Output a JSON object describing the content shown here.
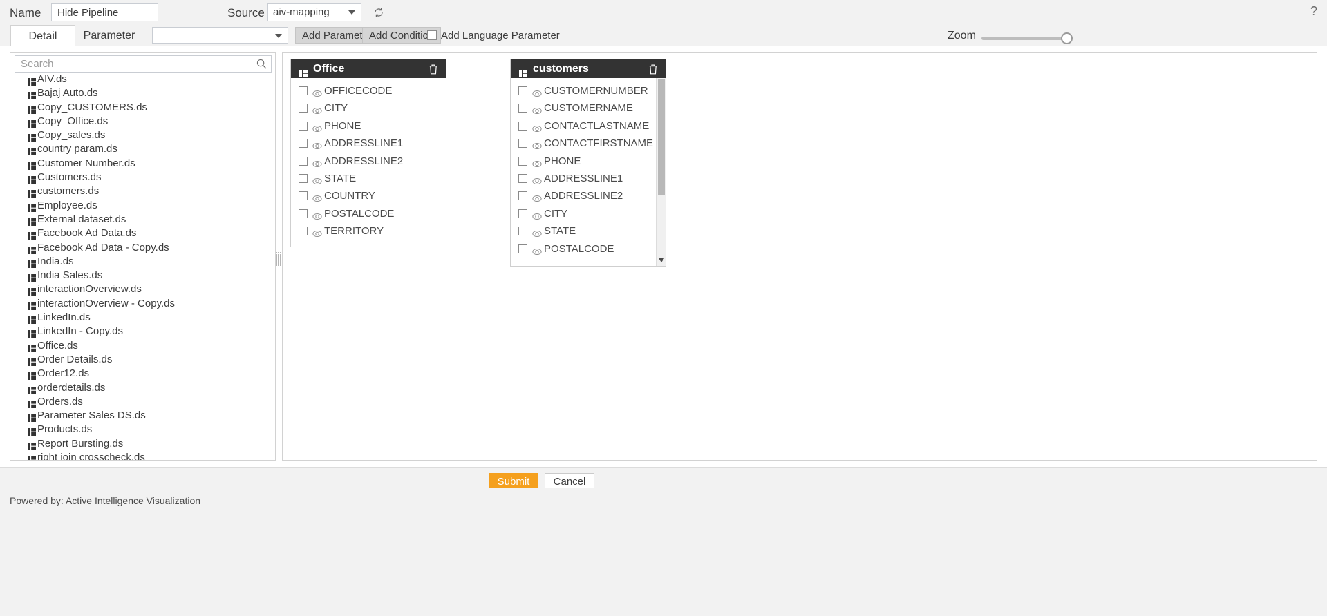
{
  "topbar": {
    "name_label": "Name",
    "name_value": "Hide Pipeline",
    "name_placeholder": "",
    "source_label": "Source",
    "source_value": "aiv-mapping",
    "refresh_icon": "refresh-icon",
    "help_icon": "help-icon",
    "help_glyph": "?"
  },
  "tabrow": {
    "tabs": [
      {
        "label": "Detail",
        "active": true
      },
      {
        "label": "Parameter",
        "active": false
      }
    ],
    "param_select_value": "",
    "add_parameter_label": "Add Parameter",
    "add_condition_label": "Add Condition",
    "add_language_parameter_label": "Add Language Parameter",
    "language_checked": false,
    "zoom_label": "Zoom",
    "zoom_value": 100
  },
  "sidebar": {
    "search_placeholder": "Search",
    "search_value": "",
    "search_icon": "search-icon",
    "items": [
      {
        "label": "AIV.ds"
      },
      {
        "label": "Bajaj Auto.ds"
      },
      {
        "label": "Copy_CUSTOMERS.ds"
      },
      {
        "label": "Copy_Office.ds"
      },
      {
        "label": "Copy_sales.ds"
      },
      {
        "label": "country param.ds"
      },
      {
        "label": "Customer Number.ds"
      },
      {
        "label": "Customers.ds"
      },
      {
        "label": "customers.ds"
      },
      {
        "label": "Employee.ds"
      },
      {
        "label": "External dataset.ds"
      },
      {
        "label": "Facebook Ad Data.ds"
      },
      {
        "label": "Facebook Ad Data - Copy.ds"
      },
      {
        "label": "India.ds"
      },
      {
        "label": "India Sales.ds"
      },
      {
        "label": "interactionOverview.ds"
      },
      {
        "label": "interactionOverview - Copy.ds"
      },
      {
        "label": "LinkedIn.ds"
      },
      {
        "label": "LinkedIn - Copy.ds"
      },
      {
        "label": "Office.ds"
      },
      {
        "label": "Order Details.ds"
      },
      {
        "label": "Order12.ds"
      },
      {
        "label": "orderdetails.ds"
      },
      {
        "label": "Orders.ds"
      },
      {
        "label": "Parameter Sales DS.ds"
      },
      {
        "label": "Products.ds"
      },
      {
        "label": "Report Bursting.ds"
      },
      {
        "label": "right join crosscheck.ds"
      }
    ]
  },
  "canvas": {
    "cards": [
      {
        "title": "Office",
        "delete_icon": "trash-icon",
        "has_scrollbar": false,
        "fields": [
          {
            "name": "OFFICECODE",
            "checked": false
          },
          {
            "name": "CITY",
            "checked": false
          },
          {
            "name": "PHONE",
            "checked": false
          },
          {
            "name": "ADDRESSLINE1",
            "checked": false
          },
          {
            "name": "ADDRESSLINE2",
            "checked": false
          },
          {
            "name": "STATE",
            "checked": false
          },
          {
            "name": "COUNTRY",
            "checked": false
          },
          {
            "name": "POSTALCODE",
            "checked": false
          },
          {
            "name": "TERRITORY",
            "checked": false
          }
        ]
      },
      {
        "title": "customers",
        "delete_icon": "trash-icon",
        "has_scrollbar": true,
        "fields": [
          {
            "name": "CUSTOMERNUMBER",
            "checked": false
          },
          {
            "name": "CUSTOMERNAME",
            "checked": false
          },
          {
            "name": "CONTACTLASTNAME",
            "checked": false
          },
          {
            "name": "CONTACTFIRSTNAME",
            "checked": false
          },
          {
            "name": "PHONE",
            "checked": false
          },
          {
            "name": "ADDRESSLINE1",
            "checked": false
          },
          {
            "name": "ADDRESSLINE2",
            "checked": false
          },
          {
            "name": "CITY",
            "checked": false
          },
          {
            "name": "STATE",
            "checked": false
          },
          {
            "name": "POSTALCODE",
            "checked": false
          }
        ]
      }
    ]
  },
  "bottombar": {
    "submit_label": "Submit",
    "cancel_label": "Cancel",
    "submit_color": "#f5a01e"
  },
  "footer": {
    "text": "Powered by: Active Intelligence Visualization"
  }
}
